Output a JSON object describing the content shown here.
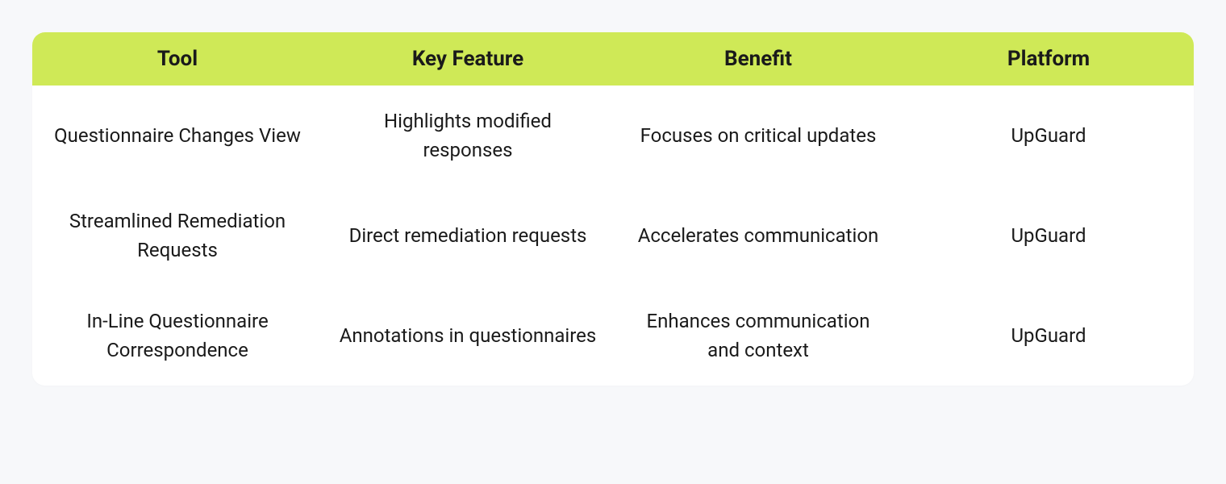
{
  "table": {
    "headers": [
      "Tool",
      "Key Feature",
      "Benefit",
      "Platform"
    ],
    "rows": [
      {
        "tool": "Questionnaire Changes View",
        "keyFeature": "Highlights modified responses",
        "benefit": "Focuses on critical updates",
        "platform": "UpGuard"
      },
      {
        "tool": "Streamlined Remediation Requests",
        "keyFeature": "Direct remediation requests",
        "benefit": "Accelerates communication",
        "platform": "UpGuard"
      },
      {
        "tool": "In-Line Questionnaire Correspondence",
        "keyFeature": "Annotations in questionnaires",
        "benefit": "Enhances communication and context",
        "platform": "UpGuard"
      }
    ]
  }
}
